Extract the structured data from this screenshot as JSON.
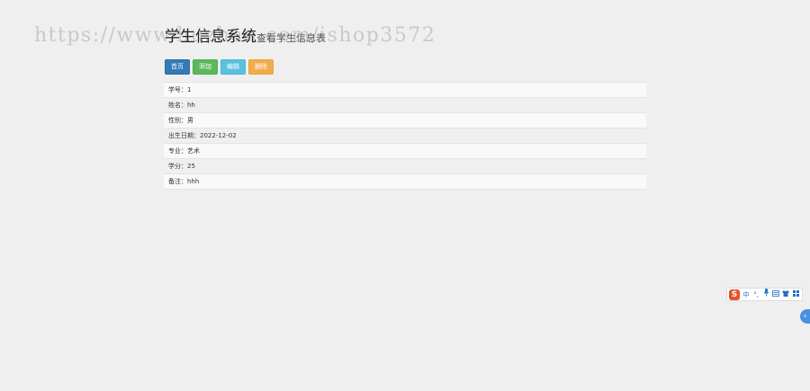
{
  "header": {
    "title": "学生信息系统",
    "subtitle": "查看学生信息表"
  },
  "watermark": "https://www.huzhan.com/ishop3572",
  "toolbar": {
    "home_label": "首页",
    "add_label": "添加",
    "edit_label": "编辑",
    "delete_label": "删除"
  },
  "student": {
    "rows": [
      {
        "label": "学号：",
        "value": "1"
      },
      {
        "label": "姓名：",
        "value": "hh"
      },
      {
        "label": "性别：",
        "value": "男"
      },
      {
        "label": "出生日期：",
        "value": "2022-12-02"
      },
      {
        "label": "专业：",
        "value": "艺术"
      },
      {
        "label": "学分：",
        "value": "25"
      },
      {
        "label": "备注：",
        "value": "hhh"
      }
    ]
  },
  "ime": {
    "logo": "S",
    "items": [
      "中",
      "°,",
      "mic-icon",
      "keyboard-icon",
      "shirt-icon",
      "grid-icon"
    ],
    "lang": "中",
    "punct": "°,"
  },
  "side_tab": {
    "icon": "chevron-left-icon"
  },
  "colors": {
    "primary": "#337ab7",
    "success": "#5cb85c",
    "info": "#5bc0de",
    "warning": "#f0ad4e",
    "ime_logo": "#e8512b"
  }
}
